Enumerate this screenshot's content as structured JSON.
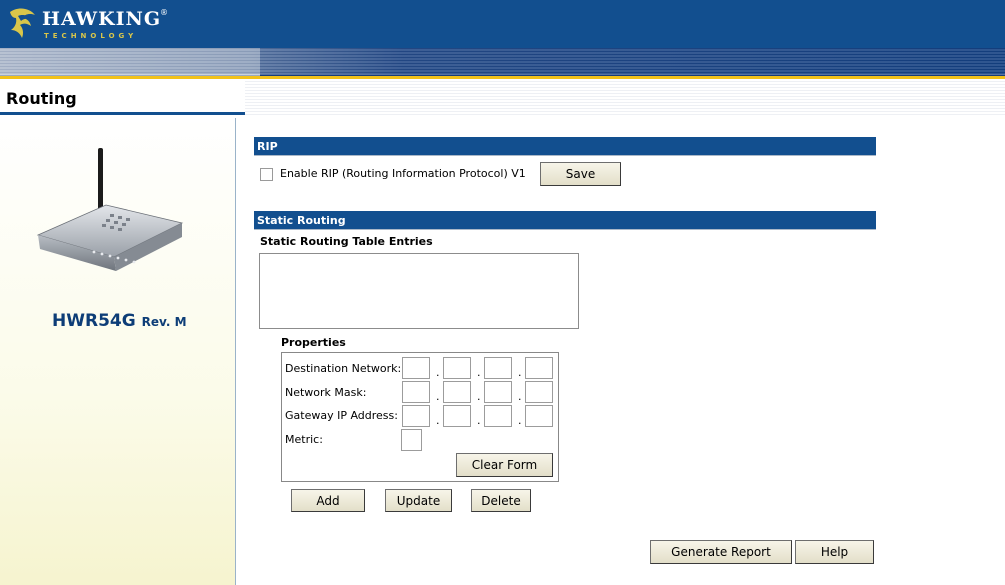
{
  "header": {
    "logo_main": "HAWKING",
    "logo_sub": "TECHNOLOGY",
    "logo_reg": "®"
  },
  "page": {
    "title": "Routing"
  },
  "sidebar": {
    "model": "HWR54G",
    "revision": "Rev. M"
  },
  "rip": {
    "section_title": "RIP",
    "checkbox_label": "Enable RIP (Routing Information Protocol) V1",
    "checkbox_checked": false,
    "save_label": "Save"
  },
  "static_routing": {
    "section_title": "Static Routing",
    "table_label": "Static Routing Table Entries",
    "entries": []
  },
  "properties": {
    "title": "Properties",
    "destination_label": "Destination Network:",
    "mask_label": "Network Mask:",
    "gateway_label": "Gateway IP Address:",
    "metric_label": "Metric:",
    "destination": [
      "",
      "",
      "",
      ""
    ],
    "mask": [
      "",
      "",
      "",
      ""
    ],
    "gateway": [
      "",
      "",
      "",
      ""
    ],
    "metric": "",
    "dot": ".",
    "clear_form_label": "Clear Form"
  },
  "actions": {
    "add_label": "Add",
    "update_label": "Update",
    "delete_label": "Delete",
    "generate_report_label": "Generate Report",
    "help_label": "Help"
  },
  "colors": {
    "brand_blue": "#124f8f",
    "accent_gold": "#f2c21a"
  }
}
